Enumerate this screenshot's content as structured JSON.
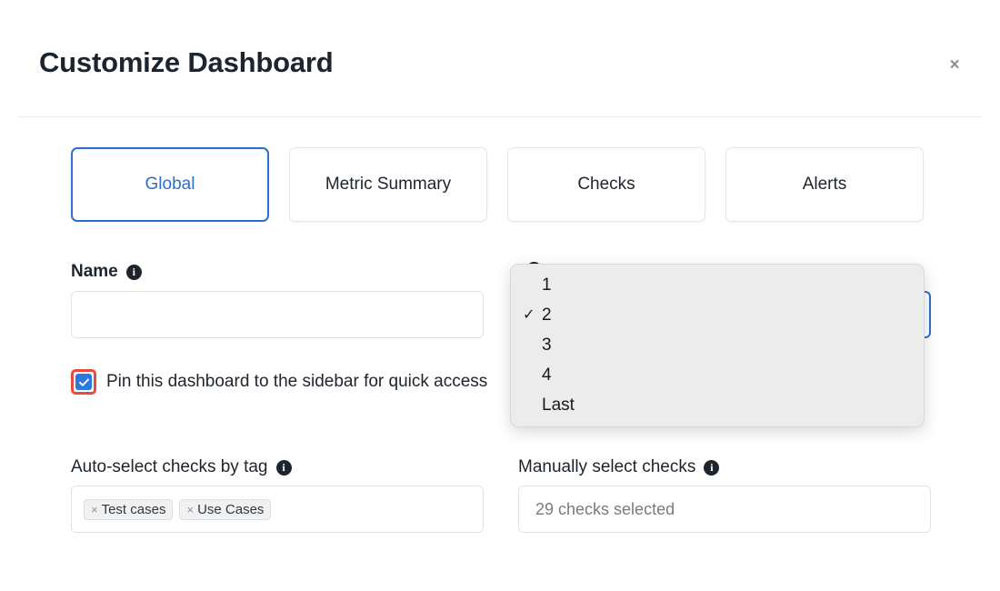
{
  "header": {
    "title": "Customize Dashboard",
    "close_label": "×"
  },
  "tabs": [
    {
      "label": "Global",
      "active": true
    },
    {
      "label": "Metric Summary",
      "active": false
    },
    {
      "label": "Checks",
      "active": false
    },
    {
      "label": "Alerts",
      "active": false
    }
  ],
  "form": {
    "name": {
      "label": "Name",
      "info": "i",
      "value": "",
      "placeholder": ""
    },
    "period": {
      "label": "",
      "info": "i",
      "value": ""
    },
    "pin_checkbox": {
      "label": "Pin this dashboard to the sidebar for quick access",
      "checked": true,
      "highlight_color": "#ea4b41",
      "checkbox_color": "#2a7ae2"
    },
    "auto_select": {
      "label": "Auto-select checks by tag",
      "info": "i",
      "chips": [
        {
          "remove": "×",
          "label": "Test cases"
        },
        {
          "remove": "×",
          "label": "Use Cases"
        }
      ]
    },
    "manual_select": {
      "label": "Manually select checks",
      "info": "i",
      "value": "29 checks selected"
    }
  },
  "dropdown": {
    "open": true,
    "selected": "2",
    "checkmark": "✓",
    "options": [
      {
        "label": "1",
        "selected": false
      },
      {
        "label": "2",
        "selected": true
      },
      {
        "label": "3",
        "selected": false
      },
      {
        "label": "4",
        "selected": false
      },
      {
        "label": "Last",
        "selected": false
      }
    ]
  },
  "colors": {
    "accent_blue": "#2c6fce",
    "checkbox_blue": "#2a7ae2",
    "highlight_red": "#ea4b41",
    "text_dark": "#1c242e",
    "menu_bg": "#ececec"
  }
}
